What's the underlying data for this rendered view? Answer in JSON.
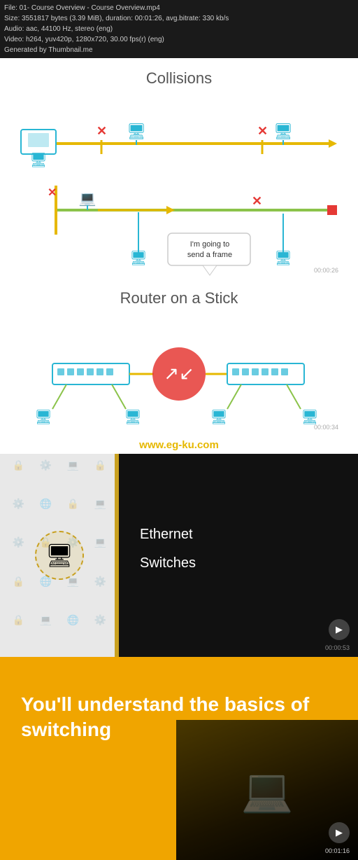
{
  "fileInfo": {
    "line1": "File: 01- Course Overview - Course Overview.mp4",
    "line2": "Size: 3551817 bytes (3.39 MiB), duration: 00:01:26, avg.bitrate: 330 kb/s",
    "line3": "Audio: aac, 44100 Hz, stereo (eng)",
    "line4": "Video: h264, yuv420p, 1280x720, 30.00 fps(r) (eng)",
    "line5": "Generated by Thumbnail.me"
  },
  "collisions": {
    "title": "Collisions",
    "callout": "I'm going to send a frame"
  },
  "router": {
    "title": "Router on a Stick"
  },
  "watermark": {
    "text": "www.eg-ku.com"
  },
  "ethernet": {
    "items": [
      "Ethernet",
      "Switches"
    ],
    "timestamp1": "00:00:26",
    "timestamp2": "00:00:34",
    "timestamp3": "00:00:53"
  },
  "understand": {
    "title": "You'll understand the basics of switching",
    "timestamp": "00:01:16"
  },
  "icons": [
    "🔒",
    "⚙️",
    "💻",
    "🔒",
    "⚙️",
    "🌐",
    "🔒",
    "💻",
    "⚙️",
    "🔒",
    "⚙️",
    "💻",
    "🔒",
    "🌐",
    "💻",
    "⚙️"
  ]
}
